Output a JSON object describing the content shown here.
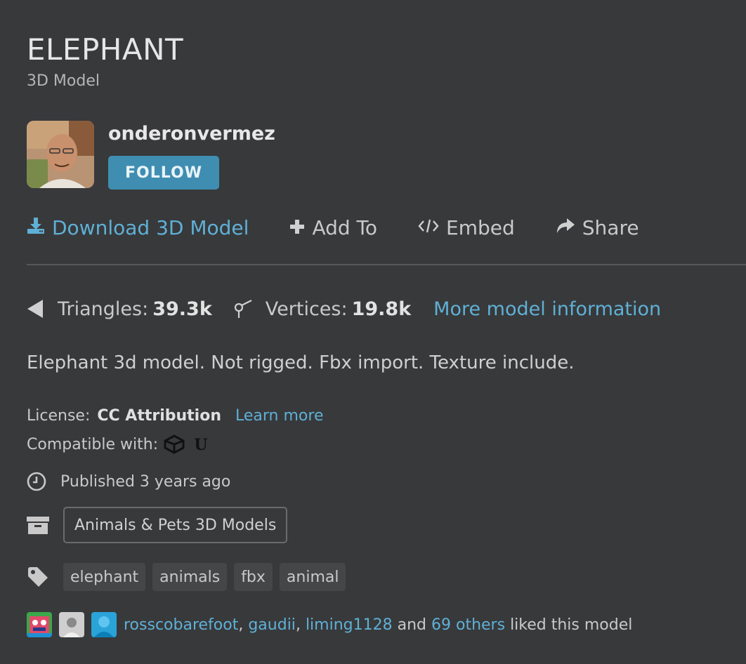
{
  "model": {
    "title": "ELEPHANT",
    "subtitle": "3D Model",
    "description": "Elephant 3d model. Not rigged. Fbx import. Texture include."
  },
  "author": {
    "username": "onderonvermez",
    "follow_label": "FOLLOW"
  },
  "actions": {
    "download": "Download 3D Model",
    "add_to": "Add To",
    "embed": "Embed",
    "share": "Share"
  },
  "stats": {
    "triangles_label": "Triangles:",
    "triangles_value": "39.3k",
    "vertices_label": "Vertices:",
    "vertices_value": "19.8k",
    "more_info": "More model information"
  },
  "license": {
    "label": "License:",
    "value": "CC Attribution",
    "learn_more": "Learn more"
  },
  "compatible": {
    "label": "Compatible with:",
    "engines": [
      "unity-icon",
      "unreal-icon"
    ]
  },
  "published": "Published 3 years ago",
  "category": "Animals & Pets 3D Models",
  "tags": [
    "elephant",
    "animals",
    "fbx",
    "animal"
  ],
  "likes": {
    "user1": "rosscobarefoot",
    "user2": "gaudii",
    "user3": "liming1128",
    "sep": ",",
    "and": "and",
    "others": "69 others",
    "suffix": "liked this model"
  },
  "colors": {
    "background": "#38393b",
    "accent": "#5fb0d6",
    "follow": "#3f8eb2"
  }
}
